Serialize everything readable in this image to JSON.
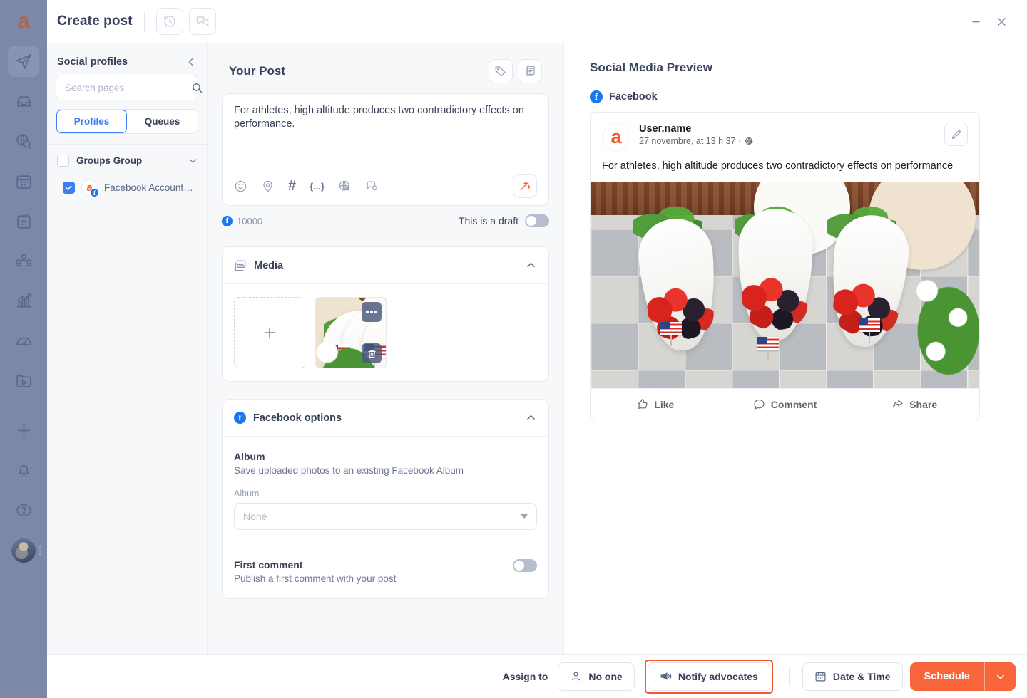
{
  "brand": {
    "logo_letter": "a",
    "accent_orange": "#f9653a",
    "accent_blue": "#3d7ef5",
    "facebook_blue": "#1877f2"
  },
  "rail": {
    "items": [
      {
        "icon": "paper-plane-icon",
        "name": "publish",
        "active": true
      },
      {
        "icon": "inbox-icon",
        "name": "inbox",
        "active": false
      },
      {
        "icon": "globe-search-icon",
        "name": "listening",
        "active": false
      },
      {
        "icon": "calendar-grid-icon",
        "name": "calendar",
        "active": false
      },
      {
        "icon": "notes-icon",
        "name": "planner",
        "active": false
      },
      {
        "icon": "users-icon",
        "name": "team",
        "active": false
      },
      {
        "icon": "chart-growth-icon",
        "name": "analytics",
        "active": false
      },
      {
        "icon": "speedometer-icon",
        "name": "performance",
        "active": false
      },
      {
        "icon": "media-library-icon",
        "name": "media-library",
        "active": false
      },
      {
        "icon": "plus-icon",
        "name": "create",
        "active": false
      },
      {
        "icon": "bell-icon",
        "name": "notifications",
        "active": false
      },
      {
        "icon": "help-circle-icon",
        "name": "help",
        "active": false
      }
    ]
  },
  "titlebar": {
    "title": "Create post",
    "history_icon": "history-clock-icon",
    "comments_icon": "comments-icon",
    "minimize_icon": "minimize-icon",
    "close_icon": "close-icon"
  },
  "profiles_panel": {
    "heading": "Social profiles",
    "collapse_icon": "chevron-left-icon",
    "search": {
      "placeholder": "Search pages",
      "value": "",
      "icon": "search-icon"
    },
    "tabs": [
      {
        "label": "Profiles",
        "active": true
      },
      {
        "label": "Queues",
        "active": false
      }
    ],
    "group": {
      "name": "Groups Group",
      "checked": false,
      "chevron_icon": "chevron-down-icon"
    },
    "profile": {
      "name": "Facebook Account…",
      "checked": true,
      "avatar_letter": "a",
      "badge": "f"
    }
  },
  "editor": {
    "heading": "Your Post",
    "tag_icon": "tag-icon",
    "templates_icon": "templates-icon",
    "text": "For athletes, high altitude produces two contradictory effects on performance.",
    "tools": [
      {
        "icon": "emoji-icon",
        "name": "emoji"
      },
      {
        "icon": "location-pin-icon",
        "name": "location"
      },
      {
        "icon": "hashtag-icon",
        "name": "hashtag",
        "glyph": "#"
      },
      {
        "icon": "variables-icon",
        "name": "variables",
        "glyph": "{...}"
      },
      {
        "icon": "globe-icon",
        "name": "link"
      },
      {
        "icon": "chat-icon",
        "name": "comment"
      }
    ],
    "magic_icon": "magic-wand-icon",
    "char_count": "10000",
    "draft_label": "This is a draft",
    "draft_on": false
  },
  "media": {
    "title": "Media",
    "icon": "image-stack-icon",
    "collapse_icon": "chevron-up-icon",
    "add_icon": "plus-icon",
    "thumb_menu_icon": "more-dots-icon",
    "thumb_delete_icon": "trash-icon"
  },
  "facebook_options": {
    "title": "Facebook options",
    "collapse_icon": "chevron-up-icon",
    "album": {
      "heading": "Album",
      "description": "Save uploaded photos to an existing Facebook Album",
      "field_label": "Album",
      "value": "None",
      "options": [
        "None"
      ]
    },
    "first_comment": {
      "heading": "First comment",
      "description": "Publish a first comment with your post",
      "enabled": false
    }
  },
  "preview": {
    "heading": "Social Media Preview",
    "network": "Facebook",
    "post": {
      "author": "User.name",
      "timestamp": "27 novembre, at 13 h 37 ·",
      "privacy_icon": "globe-icon",
      "avatar_letter": "a",
      "edit_icon": "pencil-icon",
      "text": "For athletes, high altitude produces two contradictory effects on performance",
      "actions": [
        {
          "label": "Like",
          "icon": "thumbs-up-icon"
        },
        {
          "label": "Comment",
          "icon": "comment-bubble-icon"
        },
        {
          "label": "Share",
          "icon": "share-arrow-icon"
        }
      ]
    }
  },
  "bottombar": {
    "assign_label": "Assign to",
    "assignee": {
      "label": "No one",
      "icon": "person-icon"
    },
    "notify": {
      "label": "Notify advocates",
      "icon": "megaphone-icon",
      "highlighted": true
    },
    "datetime": {
      "label": "Date & Time",
      "icon": "calendar-icon"
    },
    "schedule": {
      "label": "Schedule",
      "caret_icon": "chevron-down-icon"
    }
  }
}
